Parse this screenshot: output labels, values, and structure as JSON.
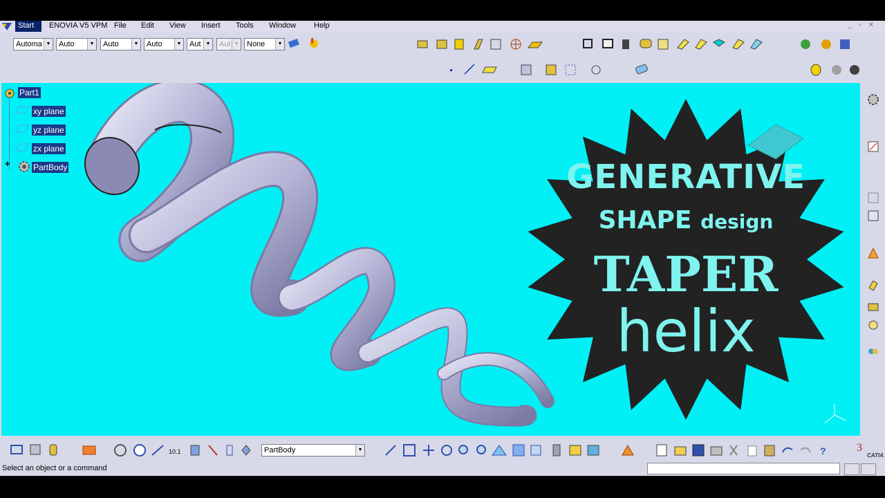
{
  "menu": {
    "start": "Start",
    "items": [
      "ENOVIA V5 VPM",
      "File",
      "Edit",
      "View",
      "Insert",
      "Tools",
      "Window",
      "Help"
    ]
  },
  "toolbar": {
    "combos": [
      "Automa",
      "Auto",
      "Auto",
      "Auto",
      "Aut",
      "Aut",
      "None"
    ]
  },
  "tree": {
    "root": "Part1",
    "items": [
      "xy plane",
      "yz plane",
      "zx plane",
      "PartBody"
    ],
    "expand_symbol": "+"
  },
  "banner": {
    "line1": "GENERATIVE",
    "line2a": "SHAPE",
    "line2b": "design",
    "line3": "TAPER",
    "line4": "helix"
  },
  "bottom": {
    "body_select": "PartBody"
  },
  "status": {
    "text": "Select an object or a command"
  },
  "brand": {
    "logo": "CATIA"
  },
  "colors": {
    "viewport_bg": "#00f0f6",
    "burst_fill": "#222222",
    "burst_text": "#7ff3ee",
    "tube": "#b8b8d8"
  }
}
